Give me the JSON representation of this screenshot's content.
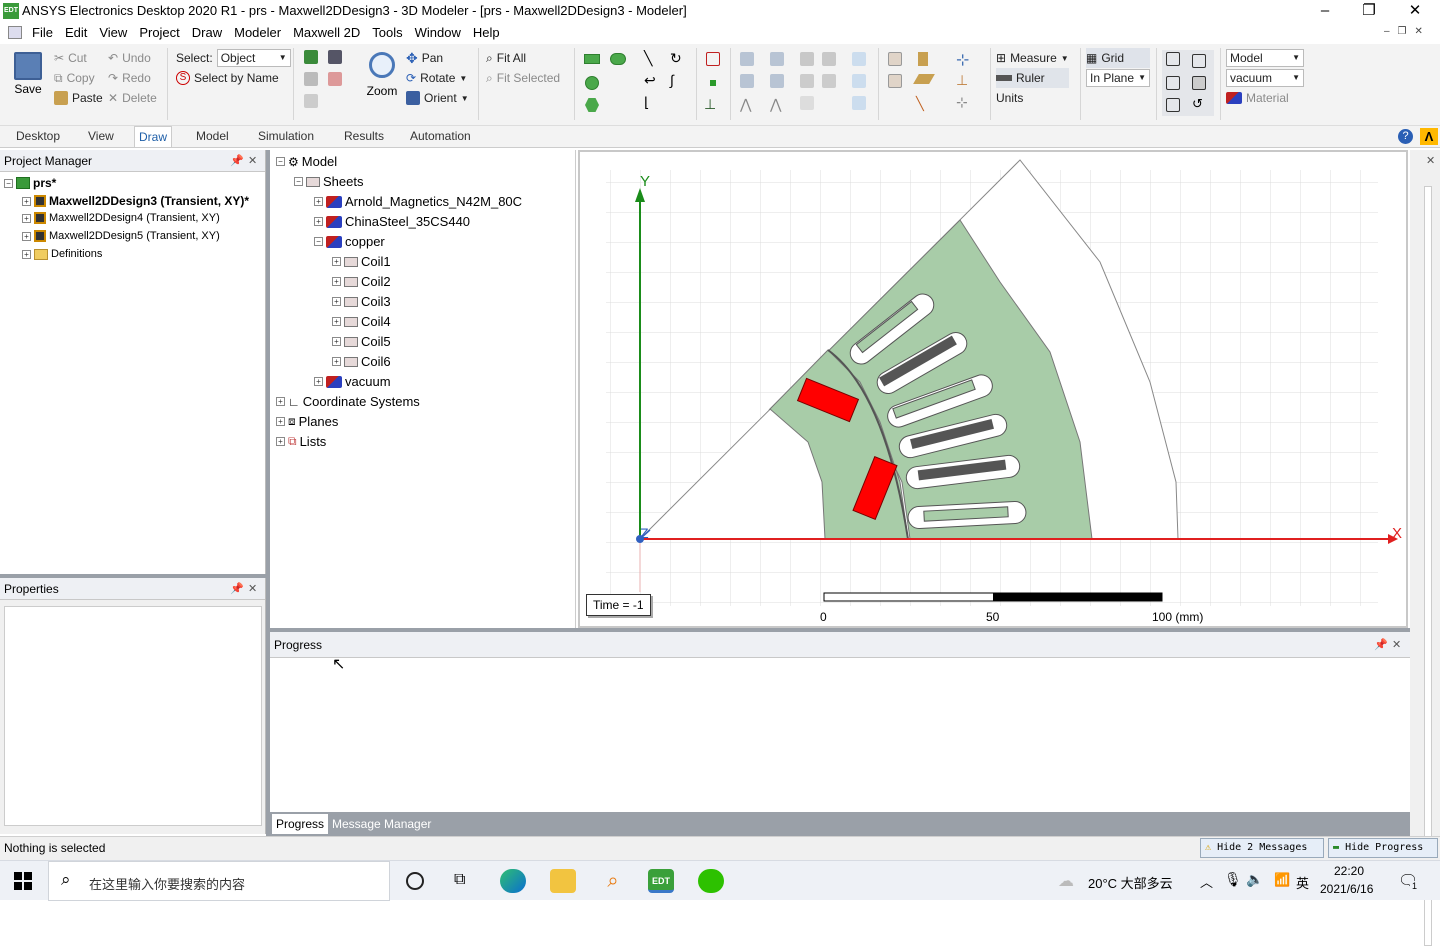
{
  "window": {
    "title": "ANSYS Electronics Desktop 2020 R1 - prs - Maxwell2DDesign3 - 3D Modeler - [prs - Maxwell2DDesign3 - Modeler]",
    "app_icon": "EDT"
  },
  "menu": [
    "File",
    "Edit",
    "View",
    "Project",
    "Draw",
    "Modeler",
    "Maxwell 2D",
    "Tools",
    "Window",
    "Help"
  ],
  "ribbon": {
    "save": "Save",
    "cut": "Cut",
    "copy": "Copy",
    "paste": "Paste",
    "undo": "Undo",
    "redo": "Redo",
    "delete": "Delete",
    "select_label": "Select:",
    "select_value": "Object",
    "select_by_name": "Select by Name",
    "zoom": "Zoom",
    "pan": "Pan",
    "rotate": "Rotate",
    "orient": "Orient",
    "fit_all": "Fit All",
    "fit_selected": "Fit Selected",
    "measure": "Measure",
    "ruler": "Ruler",
    "units": "Units",
    "grid": "Grid",
    "plane": "In Plane",
    "model_dd": "Model",
    "material_dd": "vacuum",
    "material": "Material"
  },
  "tabs": [
    "Desktop",
    "View",
    "Draw",
    "Model",
    "Simulation",
    "Results",
    "Automation"
  ],
  "project_manager": {
    "title": "Project Manager",
    "project": "prs*",
    "designs": [
      "Maxwell2DDesign3 (Transient, XY)*",
      "Maxwell2DDesign4 (Transient, XY)",
      "Maxwell2DDesign5 (Transient, XY)"
    ],
    "definitions": "Definitions"
  },
  "properties": {
    "title": "Properties"
  },
  "model_tree": {
    "model": "Model",
    "sheets": "Sheets",
    "materials": [
      "Arnold_Magnetics_N42M_80C",
      "ChinaSteel_35CS440",
      "copper"
    ],
    "coils": [
      "Coil1",
      "Coil2",
      "Coil3",
      "Coil4",
      "Coil5",
      "Coil6"
    ],
    "vacuum": "vacuum",
    "others": [
      "Coordinate Systems",
      "Planes",
      "Lists"
    ]
  },
  "viewport": {
    "time": "Time = -1",
    "axis_y": "Y",
    "axis_x": "X",
    "axis_z": "Z",
    "scale_labels": [
      "0",
      "50",
      "100 (mm)"
    ],
    "colors": {
      "steel": "#a8cca8",
      "magnet": "#ff0000",
      "coil": "#555555",
      "x_axis": "#e02020",
      "y_axis": "#1a8c1a"
    }
  },
  "progress": {
    "title": "Progress",
    "tabs": [
      "Progress",
      "Message Manager"
    ]
  },
  "statusbar": {
    "text": "Nothing is selected",
    "hide_messages": "Hide 2 Messages",
    "hide_progress": "Hide Progress"
  },
  "taskbar": {
    "search": "在这里输入你要搜索的内容",
    "weather": "20°C  大部多云",
    "ime": "英",
    "time": "22:20",
    "date": "2021/6/16",
    "notif_count": "1"
  }
}
